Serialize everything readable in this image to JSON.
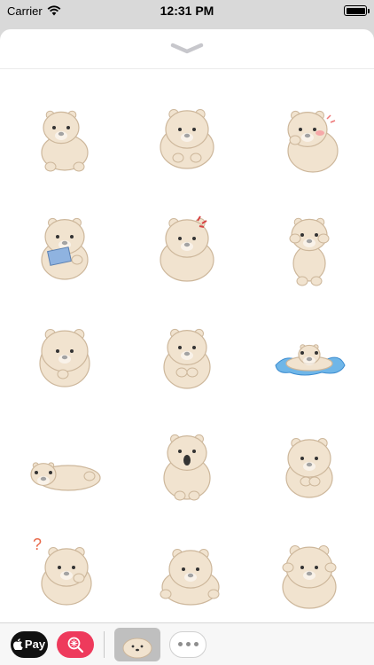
{
  "status_bar": {
    "carrier": "Carrier",
    "time": "12:31 PM",
    "battery_level": 1.0
  },
  "sheet": {
    "collapse_icon": "chevron-down-icon"
  },
  "stickers": [
    {
      "name": "bear-sitting"
    },
    {
      "name": "bear-leaning-arms"
    },
    {
      "name": "bear-blushing"
    },
    {
      "name": "bear-holding-card"
    },
    {
      "name": "bear-angry-mark"
    },
    {
      "name": "bear-standing"
    },
    {
      "name": "bear-chin-rest"
    },
    {
      "name": "bear-paws-together"
    },
    {
      "name": "bear-melting-puddle"
    },
    {
      "name": "bear-lying-down"
    },
    {
      "name": "bear-surprised"
    },
    {
      "name": "bear-shy"
    },
    {
      "name": "bear-question"
    },
    {
      "name": "bear-resting-head"
    },
    {
      "name": "bear-hands-on-cheeks"
    }
  ],
  "drawer": {
    "apple_pay_label": "Pay",
    "apps": [
      "apple-pay-icon",
      "image-search-icon",
      "sticker-pack-icon",
      "more-icon"
    ]
  },
  "colors": {
    "bear_fill": "#f1e3cf",
    "bear_stroke": "#cdb79b",
    "search_app": "#ee3a5c",
    "puddle": "#6fb6e8"
  }
}
